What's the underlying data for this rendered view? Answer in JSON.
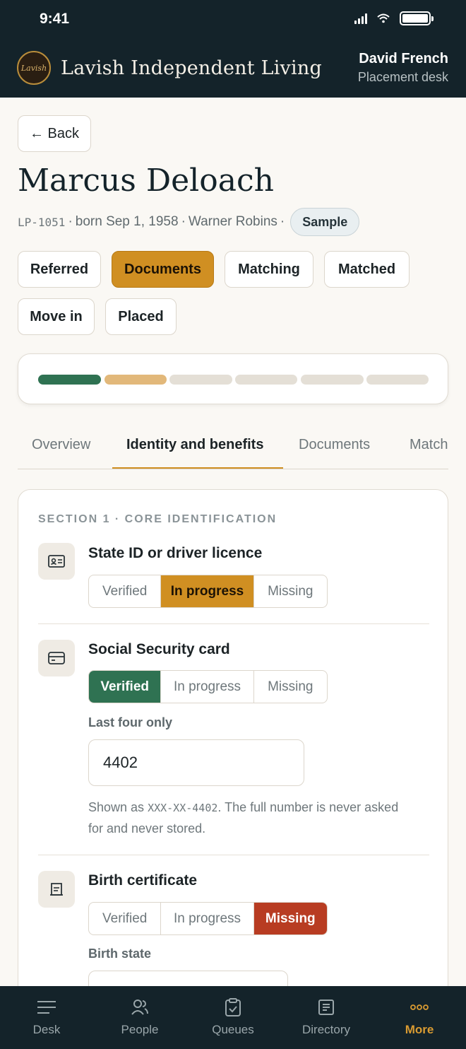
{
  "status_bar": {
    "time": "9:41"
  },
  "header": {
    "logo_text": "Lavish",
    "brand_name": "Lavish Independent Living",
    "user_name": "David French",
    "user_role": "Placement desk"
  },
  "back_label": "← Back",
  "person": {
    "name": "Marcus Deloach",
    "id": "LP-1051",
    "born": "born Sep 1, 1958",
    "city": "Warner Robins",
    "badge": "Sample"
  },
  "stages": [
    "Referred",
    "Documents",
    "Matching",
    "Matched",
    "Move in",
    "Placed"
  ],
  "active_stage": "Documents",
  "progress": {
    "segments": 6,
    "complete": 1,
    "in_progress": 1,
    "colors": {
      "complete": "#2f7252",
      "in_progress": "#e2b87a",
      "pending": "#e4dfd6"
    }
  },
  "tabs": [
    "Overview",
    "Identity and benefits",
    "Documents",
    "Matching"
  ],
  "active_tab": "Identity and benefits",
  "section": {
    "title": "SECTION 1 · CORE IDENTIFICATION",
    "options": [
      "Verified",
      "In progress",
      "Missing"
    ],
    "items": [
      {
        "title": "State ID or driver licence",
        "status": "In progress",
        "icon": "id-card-icon"
      },
      {
        "title": "Social Security card",
        "status": "Verified",
        "icon": "card-icon",
        "field_label": "Last four only",
        "field_value": "4402",
        "hint_prefix": "Shown as ",
        "hint_mono": "XXX-XX-4402",
        "hint_suffix": ". The full number is never asked for and never stored."
      },
      {
        "title": "Birth certificate",
        "status": "Missing",
        "icon": "certificate-icon",
        "field_label": "Birth state",
        "field_value": ""
      }
    ]
  },
  "bottom_nav": [
    {
      "label": "Desk",
      "icon": "menu-icon"
    },
    {
      "label": "People",
      "icon": "people-icon"
    },
    {
      "label": "Queues",
      "icon": "queue-icon"
    },
    {
      "label": "Directory",
      "icon": "directory-icon"
    },
    {
      "label": "More",
      "icon": "more-icon",
      "active": true
    }
  ]
}
